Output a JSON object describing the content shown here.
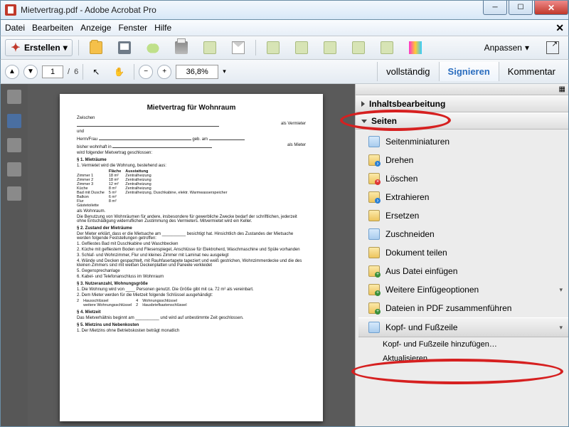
{
  "window": {
    "title": "Mietvertrag.pdf - Adobe Acrobat Pro"
  },
  "menu": {
    "items": [
      "Datei",
      "Bearbeiten",
      "Anzeige",
      "Fenster",
      "Hilfe"
    ]
  },
  "toolbar1": {
    "create": "Erstellen",
    "customize": "Anpassen"
  },
  "toolbar2": {
    "page_current": "1",
    "page_sep": "/",
    "page_total": "6",
    "zoom": "36,8%",
    "tabs": {
      "vollstaendig": "vollständig",
      "signieren": "Signieren",
      "kommentar": "Kommentar"
    }
  },
  "document": {
    "title": "Mietvertrag für Wohnraum",
    "zwischen": "Zwischen",
    "als_vermieter": "als Vermieter",
    "und": "und",
    "herrn_frau": "Herrn/Frau",
    "geb_am": "geb. am",
    "bisher_wohnhaft": "bisher wohnhaft in",
    "als_mieter": "als Mieter",
    "wird_folgender": "wird folgender Mietvertrag geschlossen:",
    "s1": "§ 1.  Mieträume",
    "s1_1": "1.  Vermietet wird die Wohnung, bestehend aus:",
    "th_flaeche": "Fläche",
    "th_ausstattung": "Ausstattung",
    "rooms": [
      [
        "Zimmer 1",
        "18 m²",
        "Zentralheizung"
      ],
      [
        "Zimmer 2",
        "18 m²",
        "Zentralheizung"
      ],
      [
        "Zimmer 3",
        "12 m²",
        "Zentralheizung"
      ],
      [
        "Küche",
        "8 m²",
        "Zentralheizung"
      ],
      [
        "Bad mit Dusche",
        "5 m²",
        "Zentralheizung, Duschkabine, elektr. Warmwasserspeicher"
      ],
      [
        "Balkon",
        "6 m²",
        ""
      ],
      [
        "Flur",
        "8 m²",
        ""
      ],
      [
        "Gästetoilette",
        "",
        ""
      ]
    ],
    "als_wohnraum": "als Wohnraum.",
    "s1_note": "Die Benutzung von Wohnräumen für andere, insbesondere für gewerbliche Zwecke bedarf der schriftlichen, jederzeit ohne Entschädigung widerruflichen Zustimmung des Vermieters. Mitvermietet wird ein Keller.",
    "s2": "§ 2.  Zustand der Mieträume",
    "s2_lead": "Der Mieter erklärt, dass er die Mietsache am __________ besichtigt hat. Hinsichtlich des Zustandes der Mietsache werden folgende Feststellungen getroffen:",
    "s2_items": [
      "1.  Gefliestes Bad mit Duschkabine und Waschbecken",
      "2.  Küche mit gefliestem Boden und Fliesenspiegel, Anschlüsse für Elektroherd, Waschmaschine und Spüle vorhanden",
      "3.  Schlaf- und Wohnzimmer, Flur und kleines Zimmer mit Laminat neu ausgelegt",
      "4.  Wände und Decken gespachtelt, mit Rauhfasertapete tapeziert und weiß gestrichen, Wohnzimmerdecke und die des kleinen Zimmers sind mit weißen Deckenplatten und Paneele verkleidet",
      "5.  Gegensprechanlage",
      "6.  Kabel- und Telefonanschluss im Wohnraum"
    ],
    "s3": "§ 3.  Nutzeranzahl, Wohnungsgröße",
    "s3_1": "1.  Die Wohnung wird von ____ Personen genutzt. Die Größe gibt mit ca. 72 m² als vereinbart.",
    "s3_2": "2.  Dem Mieter werden für die Mietzeit folgende Schlüssel ausgehändigt:",
    "s3_keys": [
      [
        "2",
        "Hausschlüssel",
        "4",
        "Wohnungsschlüssel"
      ],
      [
        "",
        "weitere Wohnungsschlüssel",
        "2",
        "Hausbriefkastenschlüssel"
      ]
    ],
    "s4": "§ 4.  Mietzeit",
    "s4_text": "Das Mietverhältnis beginnt am __________ und wird auf unbestimmte Zeit geschlossen.",
    "s5": "§ 5.  Mietzins und Nebenkosten",
    "s5_1": "1.  Der Mietzins ohne Betriebskosten beträgt monatlich"
  },
  "right_panel": {
    "sections": {
      "inhalt": "Inhaltsbearbeitung",
      "seiten": "Seiten"
    },
    "items": {
      "thumbnails": "Seitenminiaturen",
      "rotate": "Drehen",
      "delete": "Löschen",
      "extract": "Extrahieren",
      "replace": "Ersetzen",
      "crop": "Zuschneiden",
      "split": "Dokument teilen",
      "insert_file": "Aus Datei einfügen",
      "more_insert": "Weitere Einfügeoptionen",
      "combine": "Dateien in PDF zusammenführen",
      "header_footer": "Kopf- und Fußzeile",
      "add_hf": "Kopf- und Fußzeile hinzufügen…",
      "update": "Aktualisieren…"
    }
  }
}
